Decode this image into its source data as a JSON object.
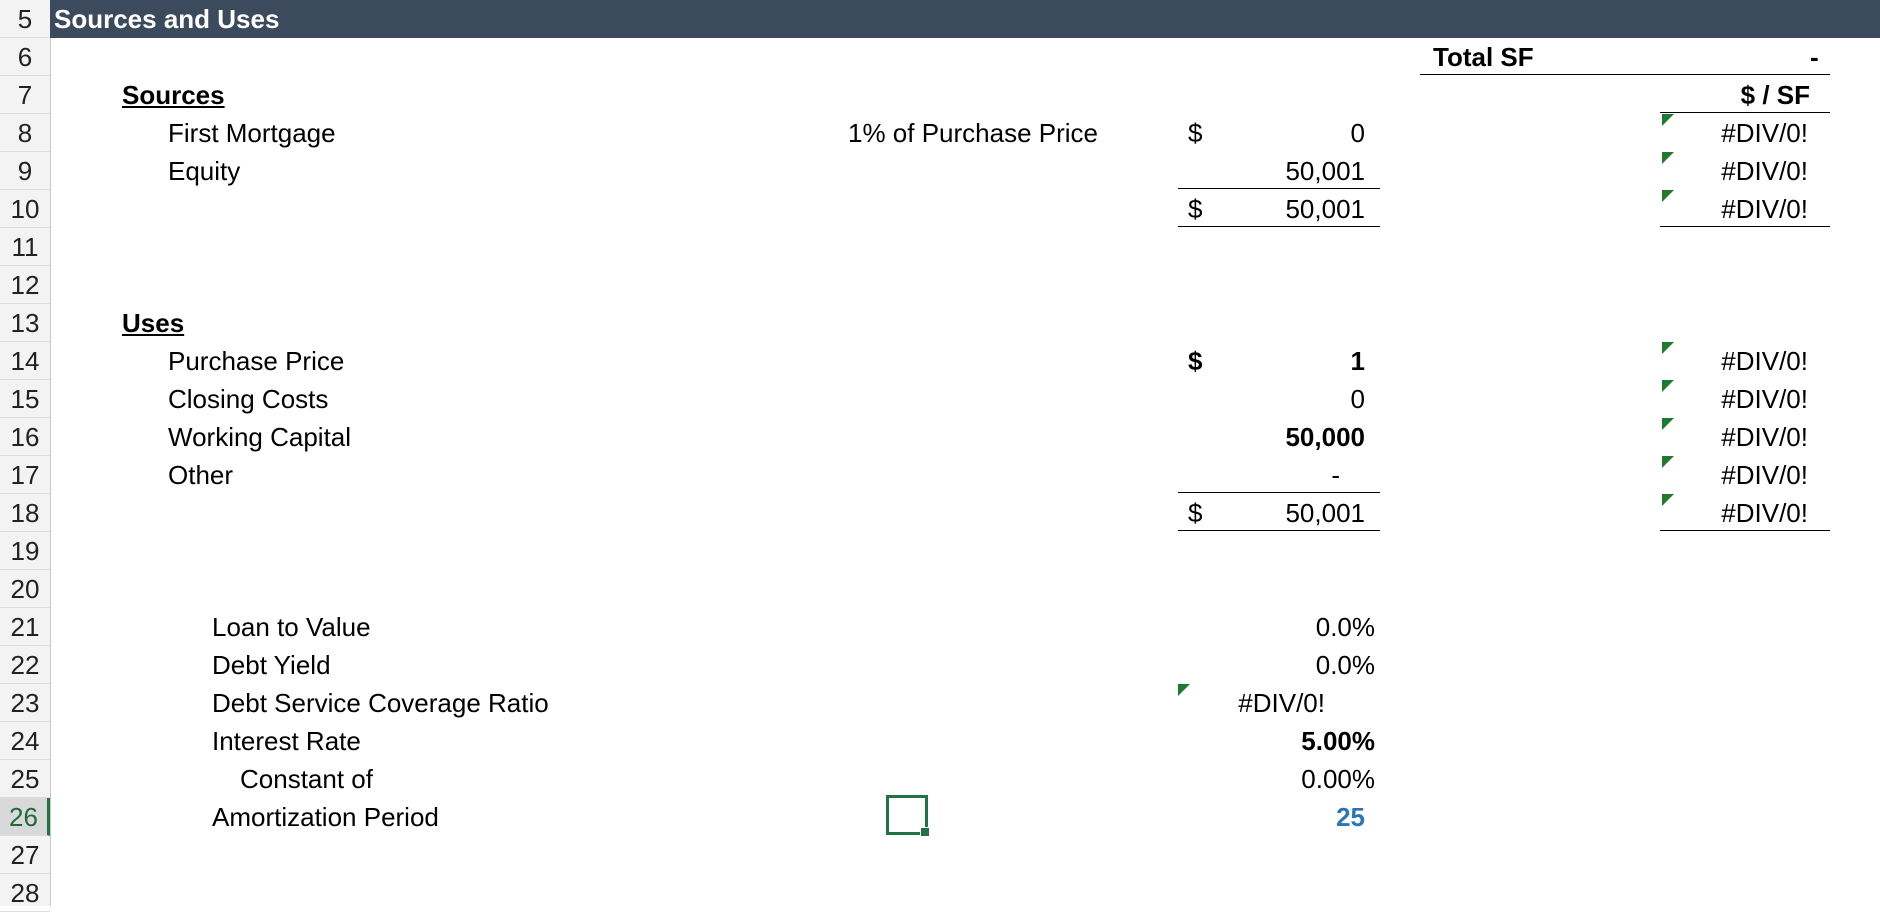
{
  "row_numbers": [
    "5",
    "6",
    "7",
    "8",
    "9",
    "10",
    "11",
    "12",
    "13",
    "14",
    "15",
    "16",
    "17",
    "18",
    "19",
    "20",
    "21",
    "22",
    "23",
    "24",
    "25",
    "26",
    "27",
    "28"
  ],
  "selected_row": "26",
  "banner": "Sources and Uses",
  "total_sf": {
    "label": "Total SF",
    "value": "-"
  },
  "per_sf_header": "$ / SF",
  "sources": {
    "title": "Sources",
    "first_mortgage": {
      "label": "First Mortgage",
      "note": "1% of Purchase Price",
      "currency": "$",
      "value": "0",
      "per_sf": "#DIV/0!"
    },
    "equity": {
      "label": "Equity",
      "value": "50,001",
      "per_sf": "#DIV/0!"
    },
    "total": {
      "currency": "$",
      "value": "50,001",
      "per_sf": "#DIV/0!"
    }
  },
  "uses": {
    "title": "Uses",
    "purchase_price": {
      "label": "Purchase Price",
      "currency": "$",
      "value": "1",
      "per_sf": "#DIV/0!"
    },
    "closing_costs": {
      "label": "Closing Costs",
      "value": "0",
      "per_sf": "#DIV/0!"
    },
    "working_capital": {
      "label": "Working Capital",
      "value": "50,000",
      "per_sf": "#DIV/0!"
    },
    "other": {
      "label": "Other",
      "value": "-",
      "per_sf": "#DIV/0!"
    },
    "total": {
      "currency": "$",
      "value": "50,001",
      "per_sf": "#DIV/0!"
    }
  },
  "metrics": {
    "ltv": {
      "label": "Loan to Value",
      "value": "0.0%"
    },
    "debt_yield": {
      "label": "Debt Yield",
      "value": "0.0%"
    },
    "dscr": {
      "label": "Debt Service Coverage Ratio",
      "value": "#DIV/0!"
    },
    "interest_rate": {
      "label": "Interest Rate",
      "value": "5.00%"
    },
    "constant": {
      "label": "Constant of",
      "value": "0.00%"
    },
    "amortization": {
      "label": "Amortization Period",
      "value": "25"
    }
  },
  "colors": {
    "banner_bg": "#3b4a5c",
    "input_blue": "#2e75b6",
    "comment_marker": "#1e7a2e",
    "selection": "#217346"
  }
}
